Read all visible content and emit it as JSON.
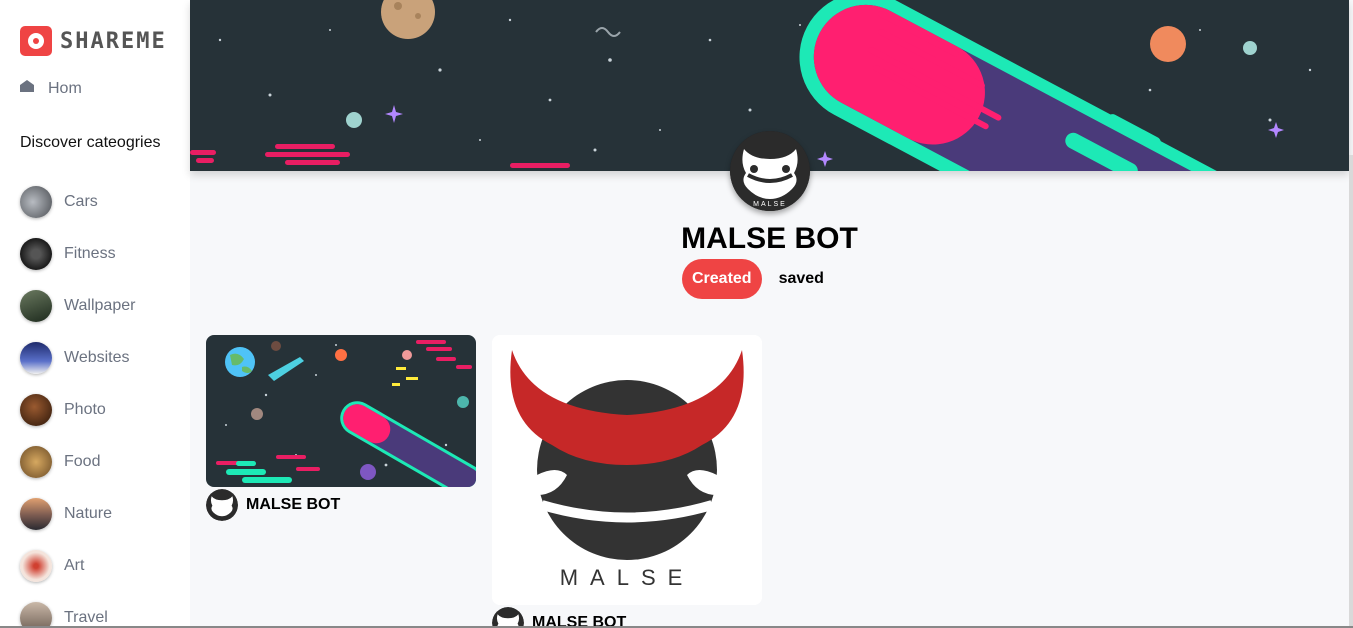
{
  "app": {
    "name": "SHAREME"
  },
  "sidebar": {
    "home_label": "Hom",
    "discover_heading": "Discover cateogries",
    "categories": [
      {
        "label": "Cars",
        "color": "#7c7f83"
      },
      {
        "label": "Fitness",
        "color": "#2f3033"
      },
      {
        "label": "Wallpaper",
        "color": "#3d4a3a"
      },
      {
        "label": "Websites",
        "color": "#253a7a"
      },
      {
        "label": "Photo",
        "color": "#5a3520"
      },
      {
        "label": "Food",
        "color": "#8a6a3a"
      },
      {
        "label": "Nature",
        "color": "#9a6a4a"
      },
      {
        "label": "Art",
        "color": "#d9a090"
      },
      {
        "label": "Travel",
        "color": "#8a7a70"
      }
    ]
  },
  "profile": {
    "name": "MALSE BOT",
    "avatar_text": "MALSE",
    "tabs": {
      "created": "Created",
      "saved": "saved"
    }
  },
  "pins": [
    {
      "user": "MALSE BOT",
      "image": "space-wallpaper"
    },
    {
      "user": "MALSE BOT",
      "image": "malse-logo",
      "logo_text": "MALSE"
    }
  ],
  "colors": {
    "accent": "#ef4444",
    "banner": "#263238"
  }
}
